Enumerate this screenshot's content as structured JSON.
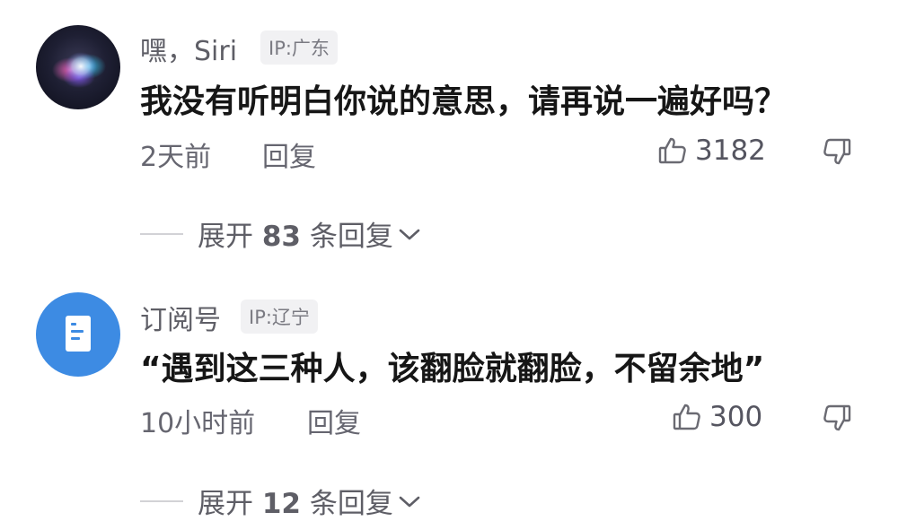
{
  "comments": [
    {
      "username": "嘿，Siri",
      "ip": "IP:广东",
      "content": "我没有听明白你说的意思，请再说一遍好吗？",
      "time": "2天前",
      "reply": "回复",
      "likes": "3182",
      "expand_prefix": "展开",
      "expand_count": "83",
      "expand_suffix": "条回复",
      "avatar_icon": "siri-orb-icon"
    },
    {
      "username": "订阅号",
      "ip": "IP:辽宁",
      "content": "“遇到这三种人，该翻脸就翻脸，不留余地”",
      "time": "10小时前",
      "reply": "回复",
      "likes": "300",
      "expand_prefix": "展开",
      "expand_count": "12",
      "expand_suffix": "条回复",
      "avatar_icon": "document-icon"
    }
  ],
  "colors": {
    "doc_avatar": "#3d8be3",
    "meta_text": "#666670",
    "content_text": "#161616"
  }
}
